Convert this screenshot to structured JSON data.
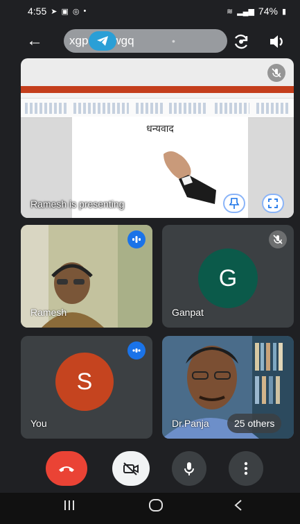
{
  "status_bar": {
    "time": "4:55",
    "battery": "74%"
  },
  "top_bar": {
    "meeting_code": "xgp‑vrb‑wgq"
  },
  "presentation": {
    "slide_title": "धन्यवाद",
    "presenting_label": "Ramesh is presenting"
  },
  "participants": [
    {
      "name": "Ramesh"
    },
    {
      "name": "Ganpat",
      "initial": "G",
      "color": "#0b5a4a"
    },
    {
      "name": "You",
      "initial": "S",
      "color": "#c5441f"
    },
    {
      "name": "Dr.Panja"
    }
  ],
  "others_label": "25 others",
  "colors": {
    "end_call": "#ea4335",
    "speaking_badge": "#1a73e8"
  },
  "icons": [
    "back-arrow-icon",
    "telegram-icon",
    "switch-camera-icon",
    "speaker-icon",
    "mic-off-icon",
    "pin-icon",
    "fullscreen-icon",
    "audio-wave-icon",
    "end-call-icon",
    "camera-off-icon",
    "mic-icon",
    "more-vert-icon",
    "nav-recents-icon",
    "nav-home-icon",
    "nav-back-icon"
  ]
}
